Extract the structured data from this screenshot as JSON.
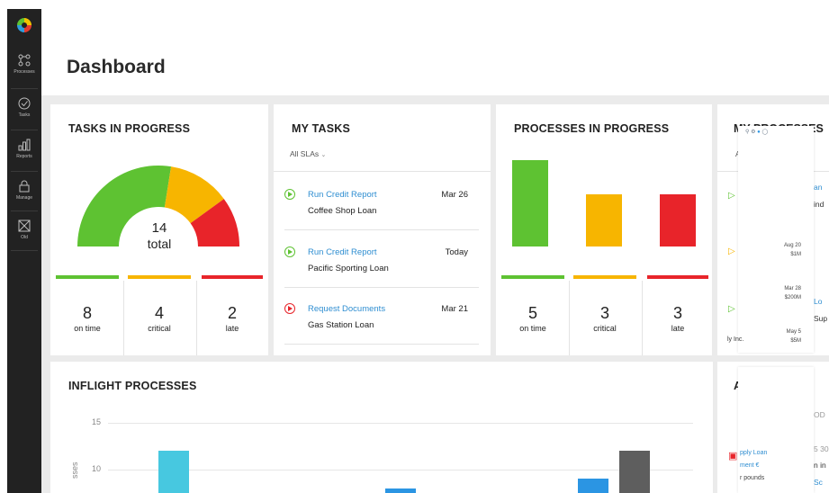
{
  "sidebar": {
    "items": [
      {
        "label": "Processes",
        "icon": "processes-icon"
      },
      {
        "label": "Tasks",
        "icon": "tasks-icon"
      },
      {
        "label": "Reports",
        "icon": "reports-icon"
      },
      {
        "label": "Manage",
        "icon": "manage-icon"
      },
      {
        "label": "Old",
        "icon": "old-icon"
      }
    ]
  },
  "page": {
    "title": "Dashboard"
  },
  "colors": {
    "green": "#5ec232",
    "yellow": "#f7b500",
    "red": "#e8242a",
    "link": "#2f8ed1",
    "cyan": "#47c8e0",
    "blue": "#2b95e3",
    "gray": "#5e5e5e"
  },
  "tasks_in_progress": {
    "title": "TASKS IN PROGRESS",
    "total_value": "14",
    "total_label": "total",
    "gauge_fractions": [
      0.55,
      0.25,
      0.2
    ],
    "stats": [
      {
        "value": "8",
        "label": "on time"
      },
      {
        "value": "4",
        "label": "critical"
      },
      {
        "value": "2",
        "label": "late"
      }
    ]
  },
  "my_tasks": {
    "title": "MY TASKS",
    "filter": "All SLAs",
    "items": [
      {
        "name": "Run Credit Report",
        "subject": "Coffee Shop Loan",
        "date": "Mar 26",
        "status": "green"
      },
      {
        "name": "Run Credit Report",
        "subject": "Pacific Sporting Loan",
        "date": "Today",
        "status": "green"
      },
      {
        "name": "Request Documents",
        "subject": "Gas Station Loan",
        "date": "Mar 21",
        "status": "red"
      }
    ]
  },
  "processes_in_progress": {
    "title": "PROCESSES IN PROGRESS",
    "bar_values": [
      5,
      3,
      3
    ],
    "stats": [
      {
        "value": "5",
        "label": "on time"
      },
      {
        "value": "3",
        "label": "critical"
      },
      {
        "value": "3",
        "label": "late"
      }
    ]
  },
  "my_processes": {
    "title": "MY PROCESSES",
    "fragments": [
      "A",
      "an",
      "ind",
      "Lo",
      "Sup",
      "A",
      "OD",
      "5 30",
      "n in",
      "Sc",
      "ly Inc.",
      "pply Loan",
      "ment €",
      "r pounds"
    ],
    "popup": [
      {
        "date": "Aug 20",
        "amount": "$1M"
      },
      {
        "date": "Mar 28",
        "amount": "$200M"
      },
      {
        "date": "May 5",
        "amount": "$5M"
      }
    ]
  },
  "inflight": {
    "title": "INFLIGHT PROCESSES",
    "y_ticks": [
      "15",
      "10"
    ],
    "y_axis_label": "sses"
  },
  "chart_data": {
    "type": "bar",
    "title": "INFLIGHT PROCESSES",
    "ylabel": "sses",
    "ylim": [
      0,
      15
    ],
    "series": [
      {
        "color": "#47c8e0",
        "values": [
          12
        ]
      },
      {
        "color": "#2b95e3",
        "values": [
          8
        ]
      },
      {
        "color": "#2b95e3",
        "values": [
          9
        ]
      },
      {
        "color": "#5e5e5e",
        "values": [
          12
        ]
      }
    ]
  }
}
